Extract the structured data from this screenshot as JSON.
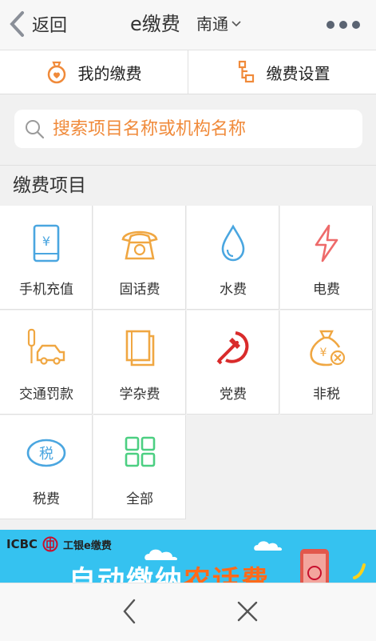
{
  "header": {
    "back_label": "返回",
    "title": "e缴费",
    "city": "南通"
  },
  "quick": {
    "my_payments": "我的缴费",
    "settings": "缴费设置"
  },
  "search": {
    "placeholder": "搜索项目名称或机构名称"
  },
  "section": {
    "title": "缴费项目"
  },
  "items": [
    {
      "label": "手机充值",
      "icon": "mobile-recharge-icon"
    },
    {
      "label": "固话费",
      "icon": "telephone-icon"
    },
    {
      "label": "水费",
      "icon": "water-drop-icon"
    },
    {
      "label": "电费",
      "icon": "lightning-icon"
    },
    {
      "label": "交通罚款",
      "icon": "traffic-car-icon"
    },
    {
      "label": "学杂费",
      "icon": "books-icon"
    },
    {
      "label": "党费",
      "icon": "party-emblem-icon"
    },
    {
      "label": "非税",
      "icon": "money-bag-icon"
    },
    {
      "label": "税费",
      "icon": "tax-icon"
    },
    {
      "label": "全部",
      "icon": "grid-icon"
    }
  ],
  "banner": {
    "brand": "ICBC",
    "name": "工银e缴费",
    "slogan_a": "自动缴纳",
    "slogan_b": "农话费"
  },
  "colors": {
    "accent": "#f08a3a",
    "blue": "#4aa6e0",
    "red": "#e03a3a",
    "green": "#4ccf82",
    "banner": "#35c2f0"
  }
}
